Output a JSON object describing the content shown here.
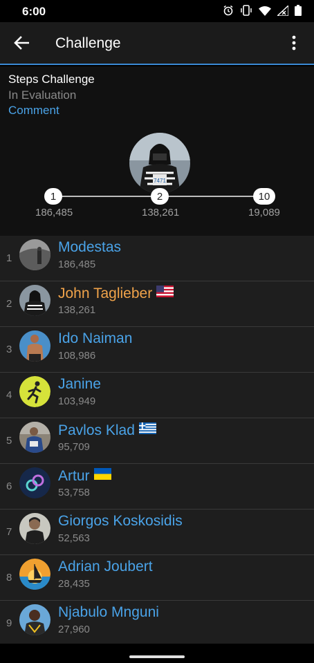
{
  "status": {
    "time": "6:00"
  },
  "appbar": {
    "title": "Challenge"
  },
  "challenge": {
    "name": "Steps Challenge",
    "status": "In Evaluation",
    "comment_label": "Comment",
    "podium": [
      {
        "rank": "1",
        "steps": "186,485"
      },
      {
        "rank": "2",
        "steps": "138,261"
      },
      {
        "rank": "10",
        "steps": "19,089"
      }
    ]
  },
  "leaderboard": [
    {
      "rank": "1",
      "name": "Modestas",
      "steps": "186,485"
    },
    {
      "rank": "2",
      "name": "John Taglieber",
      "steps": "138,261",
      "flag": "us-flag"
    },
    {
      "rank": "3",
      "name": "Ido Naiman",
      "steps": "108,986"
    },
    {
      "rank": "4",
      "name": "Janine",
      "steps": "103,949"
    },
    {
      "rank": "5",
      "name": "Pavlos Klad",
      "steps": "95,709",
      "flag": "greece-flag"
    },
    {
      "rank": "6",
      "name": "Artur",
      "steps": "53,758",
      "flag": "ukraine-flag"
    },
    {
      "rank": "7",
      "name": "Giorgos Koskosidis",
      "steps": "52,563"
    },
    {
      "rank": "8",
      "name": "Adrian Joubert",
      "steps": "28,435"
    },
    {
      "rank": "9",
      "name": "Njabulo Mnguni",
      "steps": "27,960"
    }
  ],
  "colors": {
    "accent": "#4aa3e8",
    "me": "#f0a34a",
    "divider": "#3a8ad6"
  }
}
